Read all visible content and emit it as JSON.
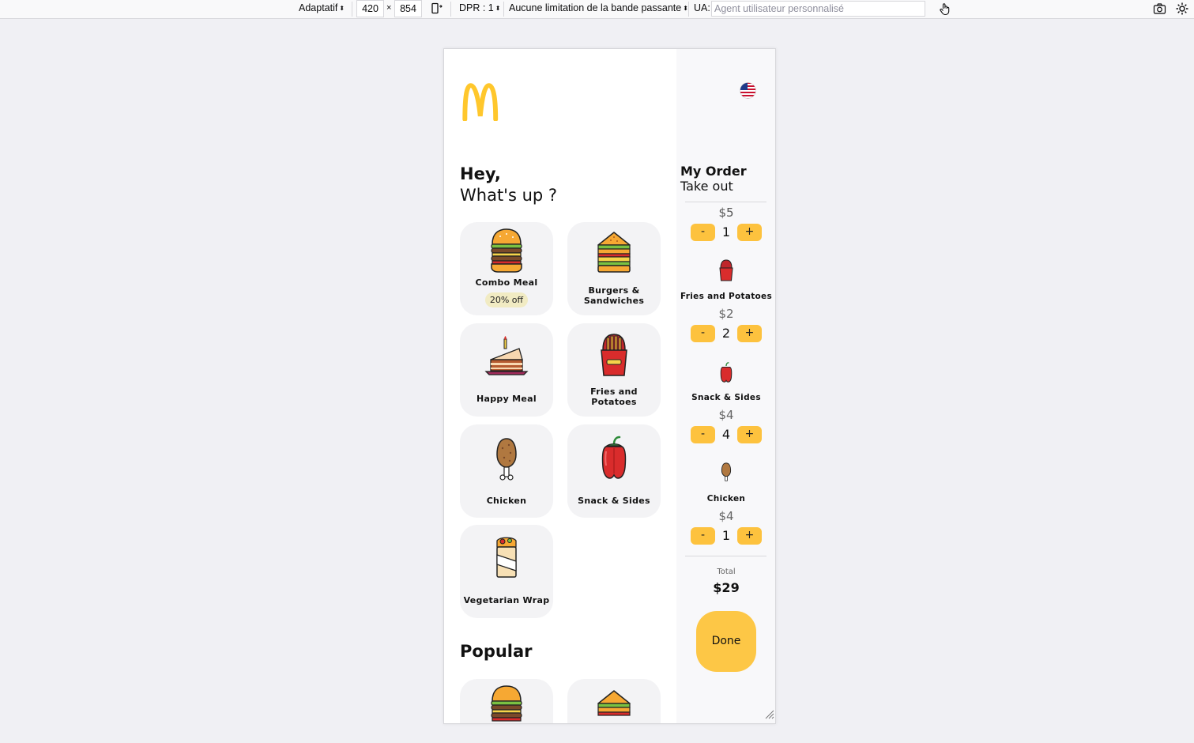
{
  "devtools": {
    "mode": "Adaptatif",
    "width": "420",
    "times": "×",
    "height": "854",
    "dpr": "DPR : 1",
    "throttle": "Aucune limitation de la bande passante",
    "ua_label": "UA:",
    "ua_placeholder": "Agent utilisateur personnalisé"
  },
  "header": {
    "greeting": "Hey,",
    "subtitle": "What's up ?"
  },
  "categories": [
    {
      "label": "Combo Meal",
      "badge": "20% off",
      "icon": "burger-icon"
    },
    {
      "label": "Burgers & Sandwiches",
      "icon": "sandwich-icon"
    },
    {
      "label": "Happy Meal",
      "icon": "cake-icon"
    },
    {
      "label": "Fries and Potatoes",
      "icon": "fries-icon"
    },
    {
      "label": "Chicken",
      "icon": "drumstick-icon"
    },
    {
      "label": "Snack & Sides",
      "icon": "pepper-icon"
    },
    {
      "label": "Vegetarian Wrap",
      "icon": "wrap-icon"
    }
  ],
  "popular": {
    "title": "Popular",
    "items": [
      {
        "icon": "burger-icon"
      },
      {
        "icon": "sandwich-icon"
      }
    ]
  },
  "order": {
    "title": "My Order",
    "mode": "Take out",
    "items": [
      {
        "label": "",
        "price": "$5",
        "qty": "1",
        "icon": ""
      },
      {
        "label": "Fries and Potatoes",
        "price": "$2",
        "qty": "2",
        "icon": "fries-icon"
      },
      {
        "label": "Snack & Sides",
        "price": "$4",
        "qty": "4",
        "icon": "pepper-icon"
      },
      {
        "label": "Chicken",
        "price": "$4",
        "qty": "1",
        "icon": "drumstick-icon"
      }
    ],
    "minus": "-",
    "plus": "+",
    "total_label": "Total",
    "total_value": "$29",
    "done_label": "Done"
  },
  "colors": {
    "brand_yellow": "#FFC72C",
    "button_yellow": "#FDC23E",
    "card_bg": "#F3F3F5",
    "badge_bg": "#F1EBC3"
  }
}
